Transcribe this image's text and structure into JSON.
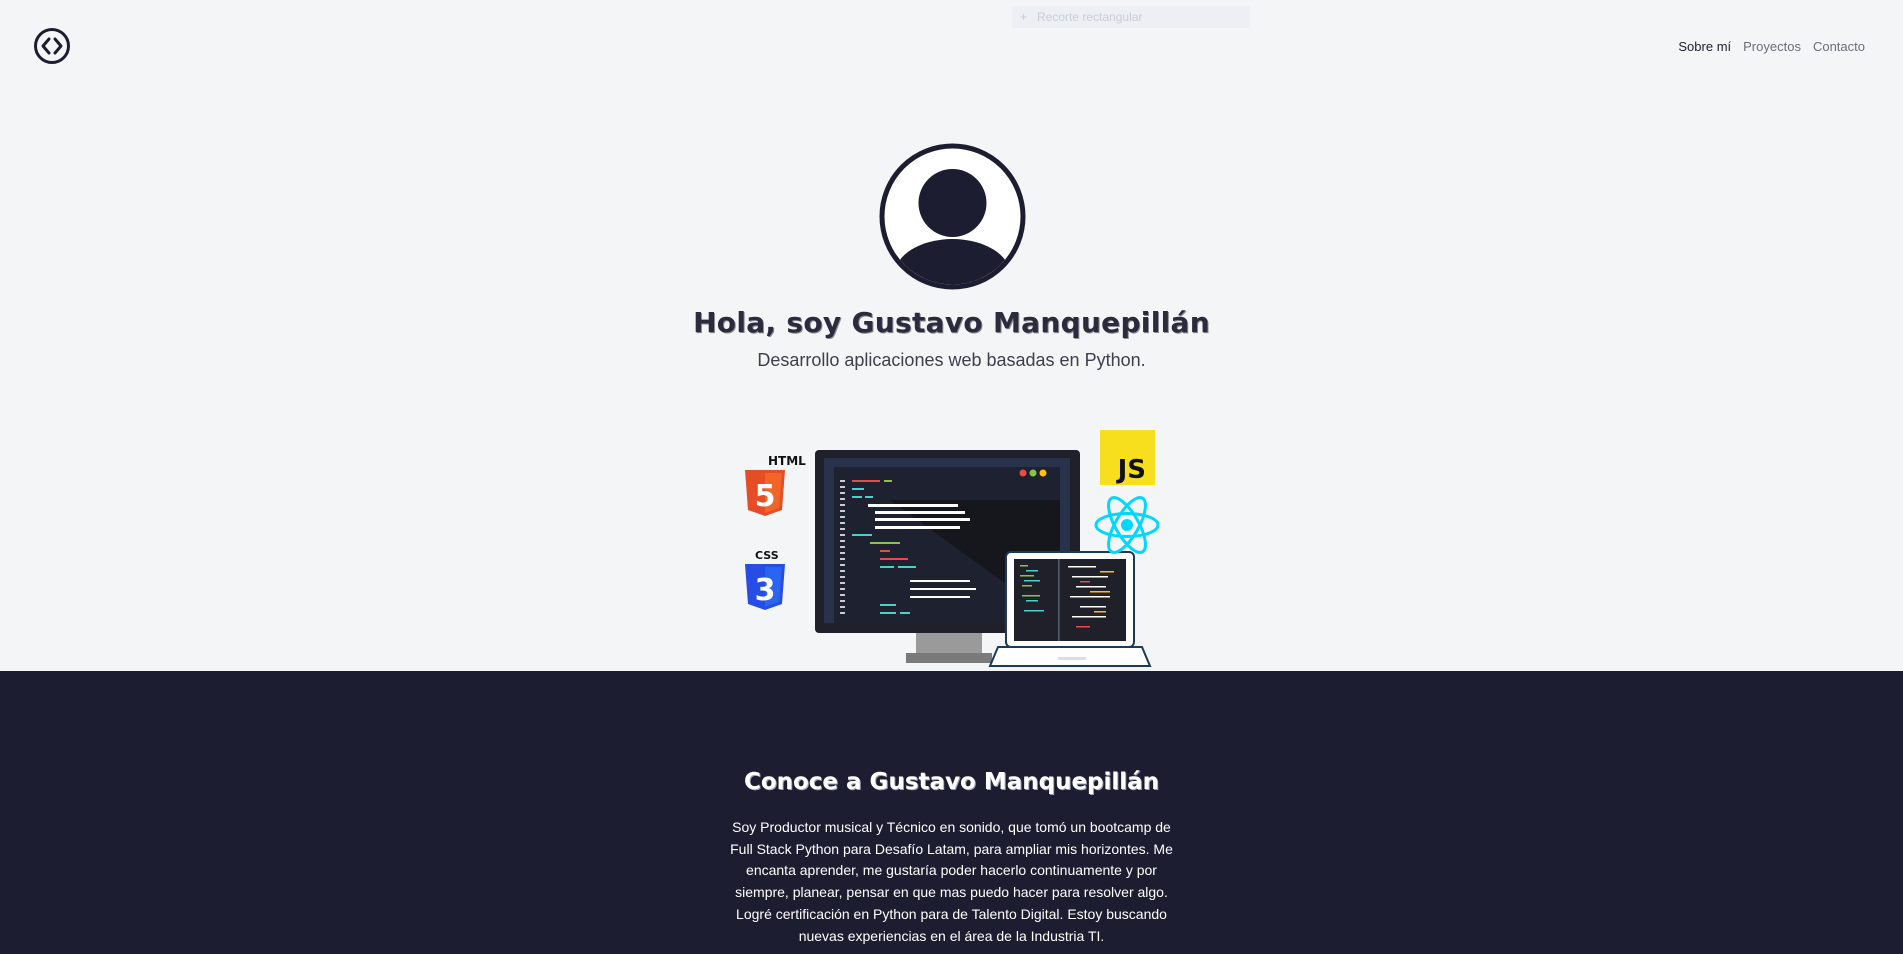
{
  "header": {
    "logo_icon": "code-brackets-icon",
    "nav": [
      {
        "label": "Sobre mí",
        "active": true
      },
      {
        "label": "Proyectos",
        "active": false
      },
      {
        "label": "Contacto",
        "active": false
      }
    ]
  },
  "snip_toolbar": {
    "label": "Recorte rectangular",
    "icon": "plus-icon"
  },
  "hero": {
    "avatar_icon": "user-avatar-icon",
    "title": "Hola, soy Gustavo Manquepillán",
    "subtitle": "Desarrollo aplicaciones web basadas en Python.",
    "illustration": {
      "icons": [
        "html5-icon",
        "css3-icon",
        "js-icon",
        "react-icon",
        "monitor-icon",
        "laptop-icon"
      ],
      "html_label": "HTML",
      "css_label": "CSS",
      "js_label": "JS",
      "html_digit": "5",
      "css_digit": "3"
    }
  },
  "about": {
    "title": "Conoce a Gustavo Manquepillán",
    "text": "Soy Productor musical y Técnico en sonido, que tomó un bootcamp de Full Stack Python para Desafío Latam, para ampliar mis horizontes. Me encanta aprender, me gustaría poder hacerlo continuamente y por siempre, planear, pensar en que mas puedo hacer para resolver algo. Logré certificación en Python para de Talento Digital. Estoy buscando nuevas experiencias en el área de la Industria TI."
  },
  "colors": {
    "background": "#f4f5f7",
    "navy": "#1c1d30",
    "html_orange": "#e44d26",
    "css_blue": "#264de4",
    "js_yellow": "#f7df1e",
    "react_cyan": "#00d8ff"
  }
}
